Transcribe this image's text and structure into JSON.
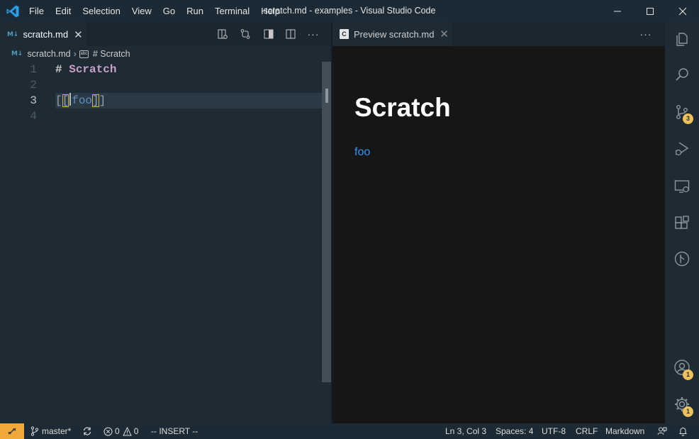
{
  "window": {
    "title": "scratch.md - examples - Visual Studio Code"
  },
  "menu": [
    "File",
    "Edit",
    "Selection",
    "View",
    "Go",
    "Run",
    "Terminal",
    "Help"
  ],
  "editor": {
    "tab_label": "scratch.md",
    "tab_icon": "M↓",
    "breadcrumb": {
      "file": "scratch.md",
      "symbol": "# Scratch"
    },
    "lines": [
      {
        "number": "1",
        "hash": "#",
        "heading": "Scratch"
      },
      {
        "number": "2"
      },
      {
        "number": "3",
        "open_outer": "[",
        "open_inner": "[",
        "link": "foo",
        "close_inner": "]",
        "close_outer": "]"
      },
      {
        "number": "4"
      }
    ]
  },
  "preview": {
    "tab_label": "Preview scratch.md",
    "heading": "Scratch",
    "link": "foo"
  },
  "activity_badges": {
    "source_control": "3",
    "accounts": "1",
    "settings": "1"
  },
  "statusbar": {
    "branch": "master*",
    "errors": "0",
    "warnings": "0",
    "mode": "-- INSERT --",
    "position": "Ln 3, Col 3",
    "spaces": "Spaces: 4",
    "encoding": "UTF-8",
    "eol": "CRLF",
    "language": "Markdown"
  },
  "colors": {
    "accent": "#3794ff",
    "badge": "#f0c15b",
    "remote": "#f0a83a",
    "heading_syntax": "#c8a0c8"
  }
}
